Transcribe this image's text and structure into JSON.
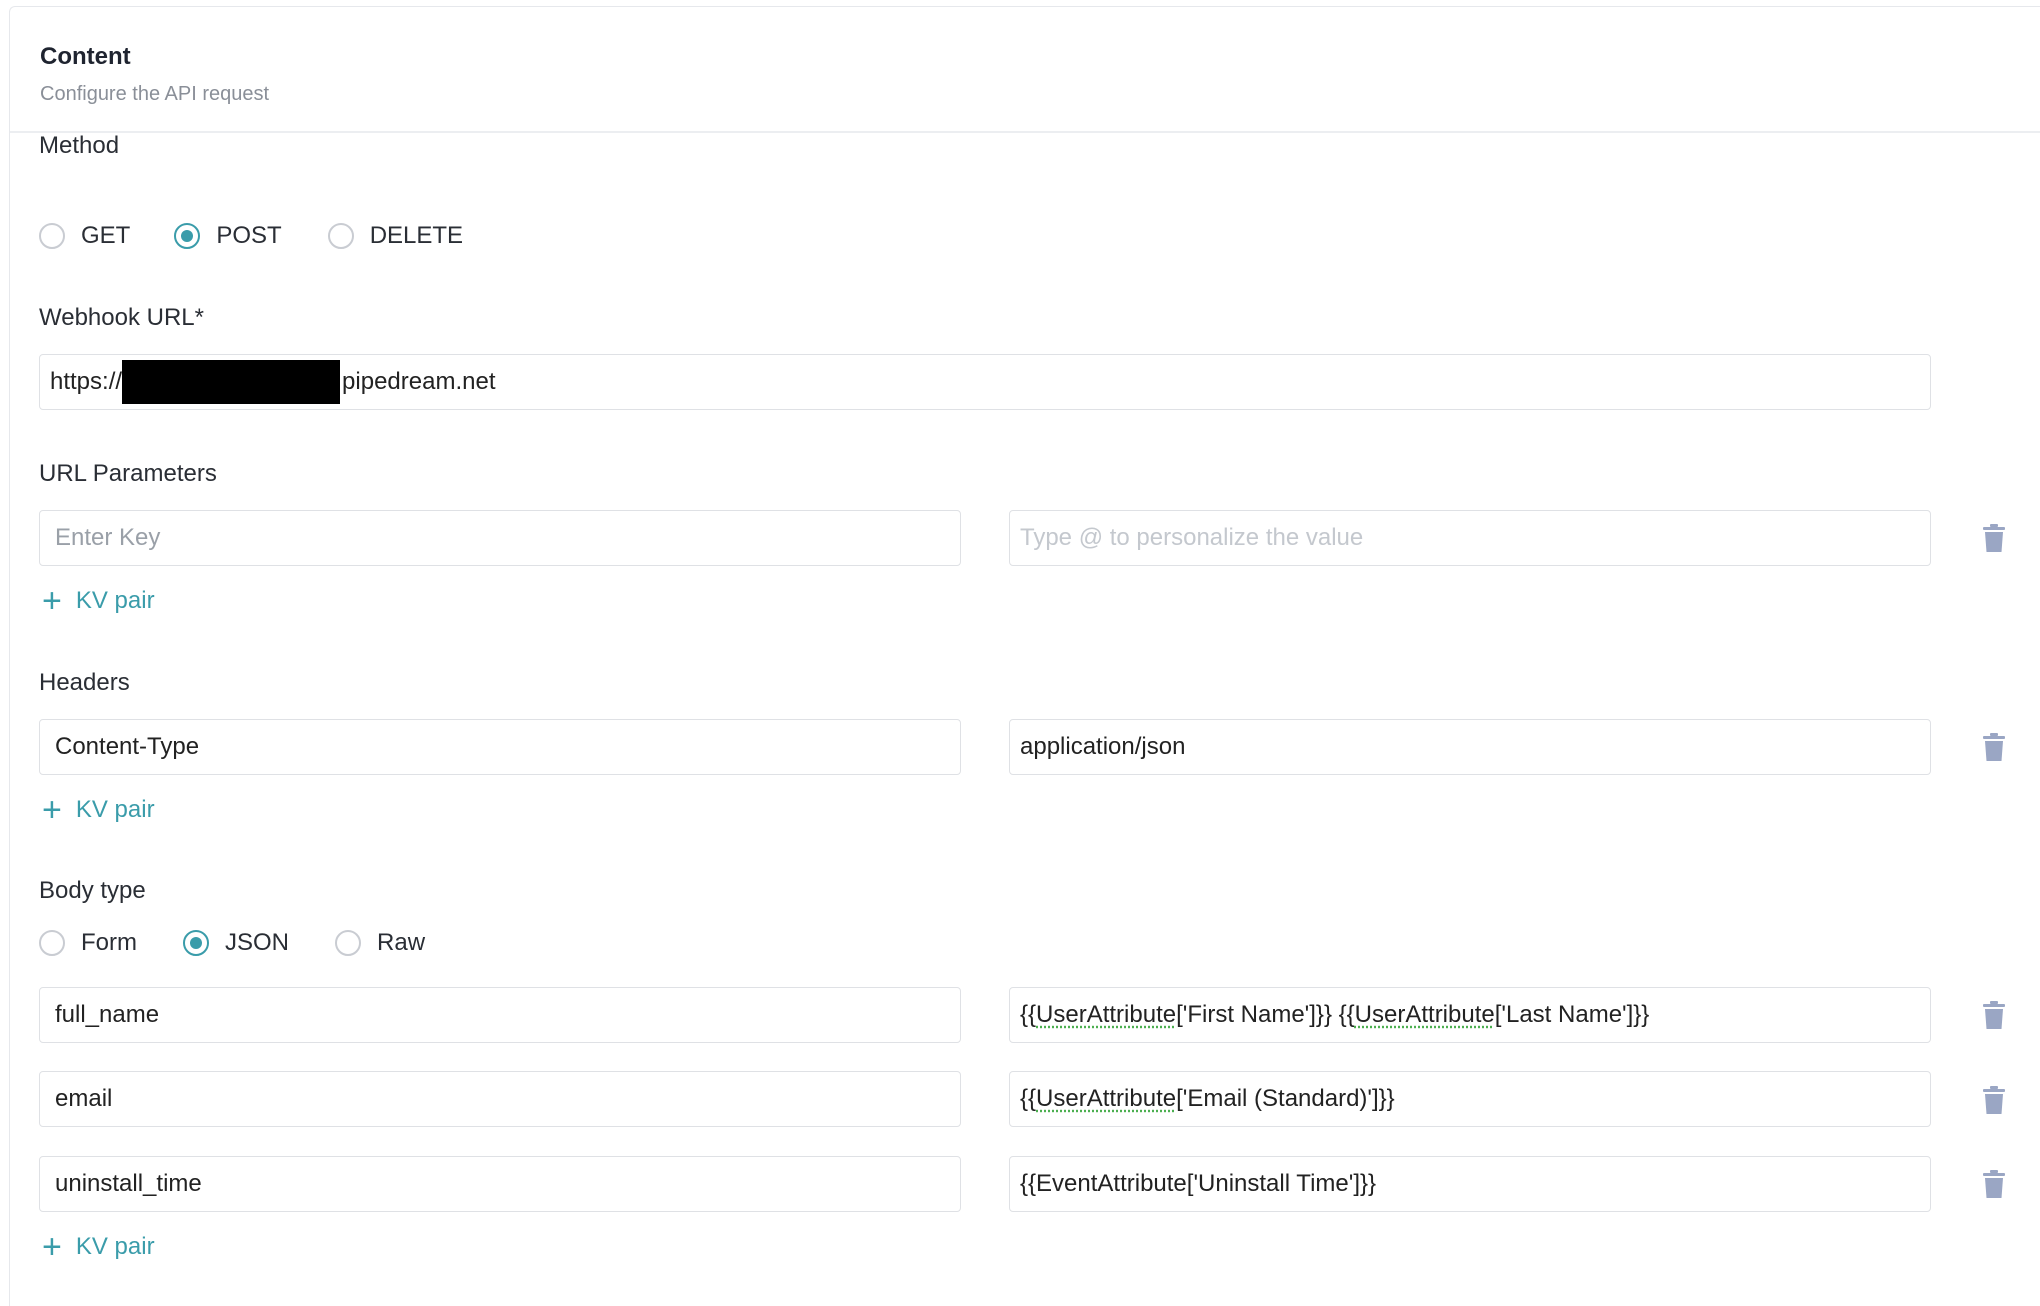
{
  "header": {
    "title": "Content",
    "subtitle": "Configure the API request"
  },
  "method": {
    "label": "Method",
    "options": [
      "GET",
      "POST",
      "DELETE"
    ],
    "selected": "POST"
  },
  "webhook": {
    "label": "Webhook URL*",
    "url_prefix": "https://",
    "url_suffix": "pipedream.net"
  },
  "url_parameters": {
    "label": "URL Parameters",
    "key_placeholder": "Enter Key",
    "value_placeholder": "Type @ to personalize the value",
    "add_label": "KV pair"
  },
  "headers": {
    "label": "Headers",
    "rows": [
      {
        "key": "Content-Type",
        "value": "application/json"
      }
    ],
    "add_label": "KV pair"
  },
  "body_type": {
    "label": "Body type",
    "options": [
      "Form",
      "JSON",
      "Raw"
    ],
    "selected": "JSON",
    "rows": [
      {
        "key": "full_name",
        "value_parts": [
          "{{",
          "UserAttribute",
          "['First Name']}} {{",
          "UserAttribute",
          "['Last Name']}}"
        ]
      },
      {
        "key": "email",
        "value_parts": [
          "{{",
          "UserAttribute",
          "['Email (Standard)']}}"
        ]
      },
      {
        "key": "uninstall_time",
        "value": "{{EventAttribute['Uninstall Time']}}"
      }
    ],
    "add_label": "KV pair"
  },
  "colors": {
    "accent": "#3a9caa",
    "trash": "#9aa6c4"
  }
}
